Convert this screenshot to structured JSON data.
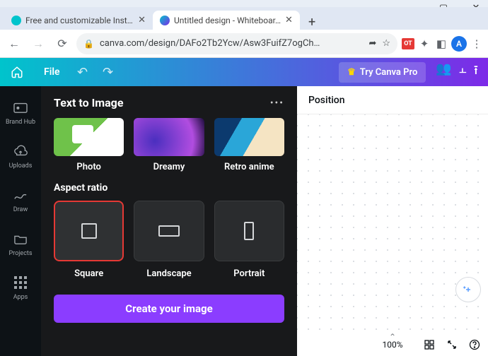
{
  "window": {
    "minimize": "—",
    "maximize": "▢",
    "close": "✕",
    "dropdown": "⌄"
  },
  "tabs": {
    "t0": {
      "title": "Free and customizable Instag…",
      "close": "✕"
    },
    "t1": {
      "title": "Untitled design - Whiteboar…",
      "close": "✕"
    },
    "new": "+"
  },
  "urlbar": {
    "back": "←",
    "forward": "→",
    "reload": "⟳",
    "lock": "🔒",
    "url": "canva.com/design/DAFo2Tb2Ycw/Asw3FuifZ7ogCh…",
    "share": "➦",
    "star": "☆",
    "ot": "OT",
    "puzzle": "✦",
    "window": "◧",
    "avatar": "A",
    "menu": "⋮"
  },
  "header": {
    "file": "File",
    "undo": "↶",
    "redo": "↷",
    "try_pro": "Try Canva Pro",
    "crown": "♛",
    "invite": "👥",
    "insights": "⫠",
    "share": "⭱"
  },
  "rail": {
    "brandhub": "Brand Hub",
    "uploads": "Uploads",
    "draw": "Draw",
    "projects": "Projects",
    "apps": "Apps"
  },
  "panel": {
    "title": "Text to Image",
    "dots": "•••",
    "style_photo": "Photo",
    "style_dreamy": "Dreamy",
    "style_retro": "Retro anime",
    "aspect_title": "Aspect ratio",
    "aspect_square": "Square",
    "aspect_landscape": "Landscape",
    "aspect_portrait": "Portrait",
    "create": "Create your image"
  },
  "canvas": {
    "position": "Position",
    "zoom": "100%",
    "caret": "⌃"
  }
}
